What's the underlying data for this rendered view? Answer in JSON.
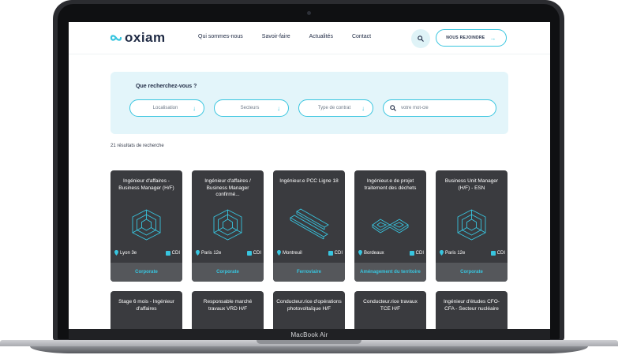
{
  "device": {
    "label": "MacBook Air"
  },
  "header": {
    "logo_text": "oxiam",
    "nav": [
      "Qui sommes-nous",
      "Savoir-faire",
      "Actualités",
      "Contact"
    ],
    "join_label": "NOUS REJOINDRE"
  },
  "search": {
    "title": "Que recherchez-vous ?",
    "filters": [
      "Localisation",
      "Secteurs",
      "Type de contrat"
    ],
    "keyword_placeholder": "votre mot-clé",
    "keyword_value": ""
  },
  "results_text": "21 résultats de recherche",
  "cards": [
    {
      "title": "Ingénieur d'affaires - Business Manager (H/F)",
      "location": "Lyon 3e",
      "contract": "CDI",
      "sector": "Corporate",
      "illustration": "hexagon"
    },
    {
      "title": "Ingénieur d'affaires / Business Manager confirmé...",
      "location": "Paris 12e",
      "contract": "CDI",
      "sector": "Corporate",
      "illustration": "hexagon"
    },
    {
      "title": "Ingénieur.e PCC Ligne 18",
      "location": "Montreuil",
      "contract": "CDI",
      "sector": "Ferroviaire",
      "illustration": "rails"
    },
    {
      "title": "Ingénieur.e de projet traitement des déchets",
      "location": "Bordeaux",
      "contract": "CDI",
      "sector": "Aménagement du territoire",
      "illustration": "loop"
    },
    {
      "title": "Business Unit Manager (H/F) - ESN",
      "location": "Paris 12e",
      "contract": "CDI",
      "sector": "Corporate",
      "illustration": "hexagon"
    }
  ],
  "cards_row2": [
    {
      "title": "Stage 6 mois - Ingénieur d'affaires"
    },
    {
      "title": "Responsable marché travaux VRD H/F"
    },
    {
      "title": "Conducteur.rice d'opérations photovoltaïque H/F"
    },
    {
      "title": "Conducteur.rice travaux TCE H/F"
    },
    {
      "title": "Ingénieur d'études CFO-CFA - Secteur nucléaire"
    }
  ],
  "colors": {
    "accent": "#38c5df",
    "navy": "#1f2a44",
    "card": "#3a3b3f",
    "panel": "#e3f5fa"
  }
}
